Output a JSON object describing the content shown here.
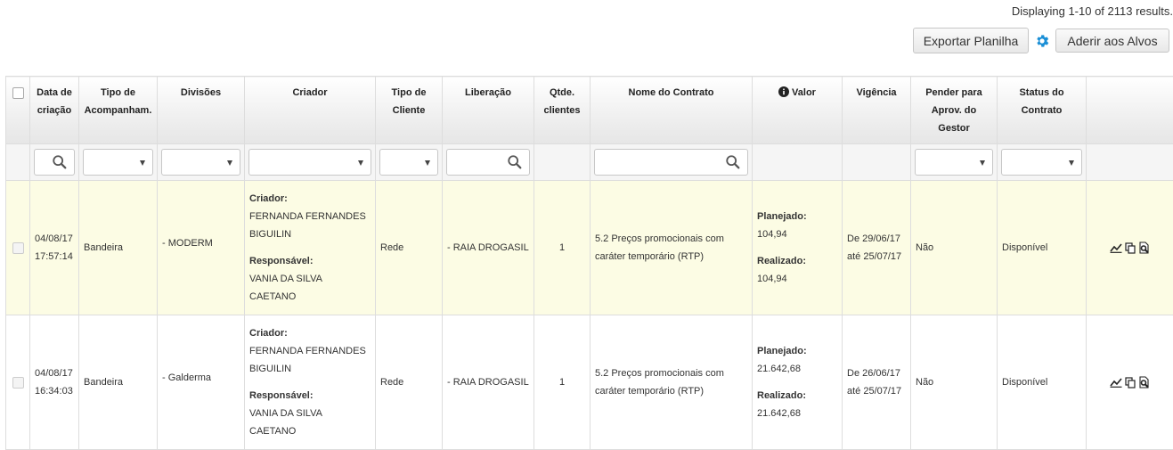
{
  "results_text": "Displaying 1-10 of 2113 results.",
  "toolbar": {
    "export_label": "Exportar Planilha",
    "settings_icon": "gear-icon",
    "adherir_label": "Aderir aos Alvos",
    "accent_color": "#1a8fd6"
  },
  "columns": {
    "data_criacao": "Data de criação",
    "tipo_acomp": "Tipo de Acompanham.",
    "divisoes": "Divisões",
    "criador": "Criador",
    "tipo_cliente": "Tipo de Cliente",
    "liberacao": "Liberação",
    "qtde_clientes": "Qtde. clientes",
    "nome_contrato": "Nome do Contrato",
    "valor": "Valor",
    "vigencia": "Vigência",
    "pender": "Pender para Aprov. do Gestor",
    "status": "Status do Contrato"
  },
  "rows": [
    {
      "date": "04/08/17",
      "time": "17:57:14",
      "tipo": "Bandeira",
      "divisao": "- MODERM",
      "criador_label": "Criador:",
      "criador_name": "FERNANDA FERNANDES BIGUILIN",
      "responsavel_label": "Responsável:",
      "responsavel_name": "VANIA DA SILVA CAETANO",
      "tipo_cliente": "Rede",
      "liberacao": "- RAIA DROGASIL",
      "qtde": "1",
      "contrato": "5.2 Preços promocionais com caráter temporário (RTP)",
      "planejado_label": "Planejado:",
      "planejado": "104,94",
      "realizado_label": "Realizado:",
      "realizado": "104,94",
      "vig_de": "De 29/06/17",
      "vig_ate": "até 25/07/17",
      "pender": "Não",
      "status": "Disponível"
    },
    {
      "date": "04/08/17",
      "time": "16:34:03",
      "tipo": "Bandeira",
      "divisao": "- Galderma",
      "criador_label": "Criador:",
      "criador_name": "FERNANDA FERNANDES BIGUILIN",
      "responsavel_label": "Responsável:",
      "responsavel_name": "VANIA DA SILVA CAETANO",
      "tipo_cliente": "Rede",
      "liberacao": "- RAIA DROGASIL",
      "qtde": "1",
      "contrato": "5.2 Preços promocionais com caráter temporário (RTP)",
      "planejado_label": "Planejado:",
      "planejado": "21.642,68",
      "realizado_label": "Realizado:",
      "realizado": "21.642,68",
      "vig_de": "De 26/06/17",
      "vig_ate": "até 25/07/17",
      "pender": "Não",
      "status": "Disponível"
    }
  ]
}
